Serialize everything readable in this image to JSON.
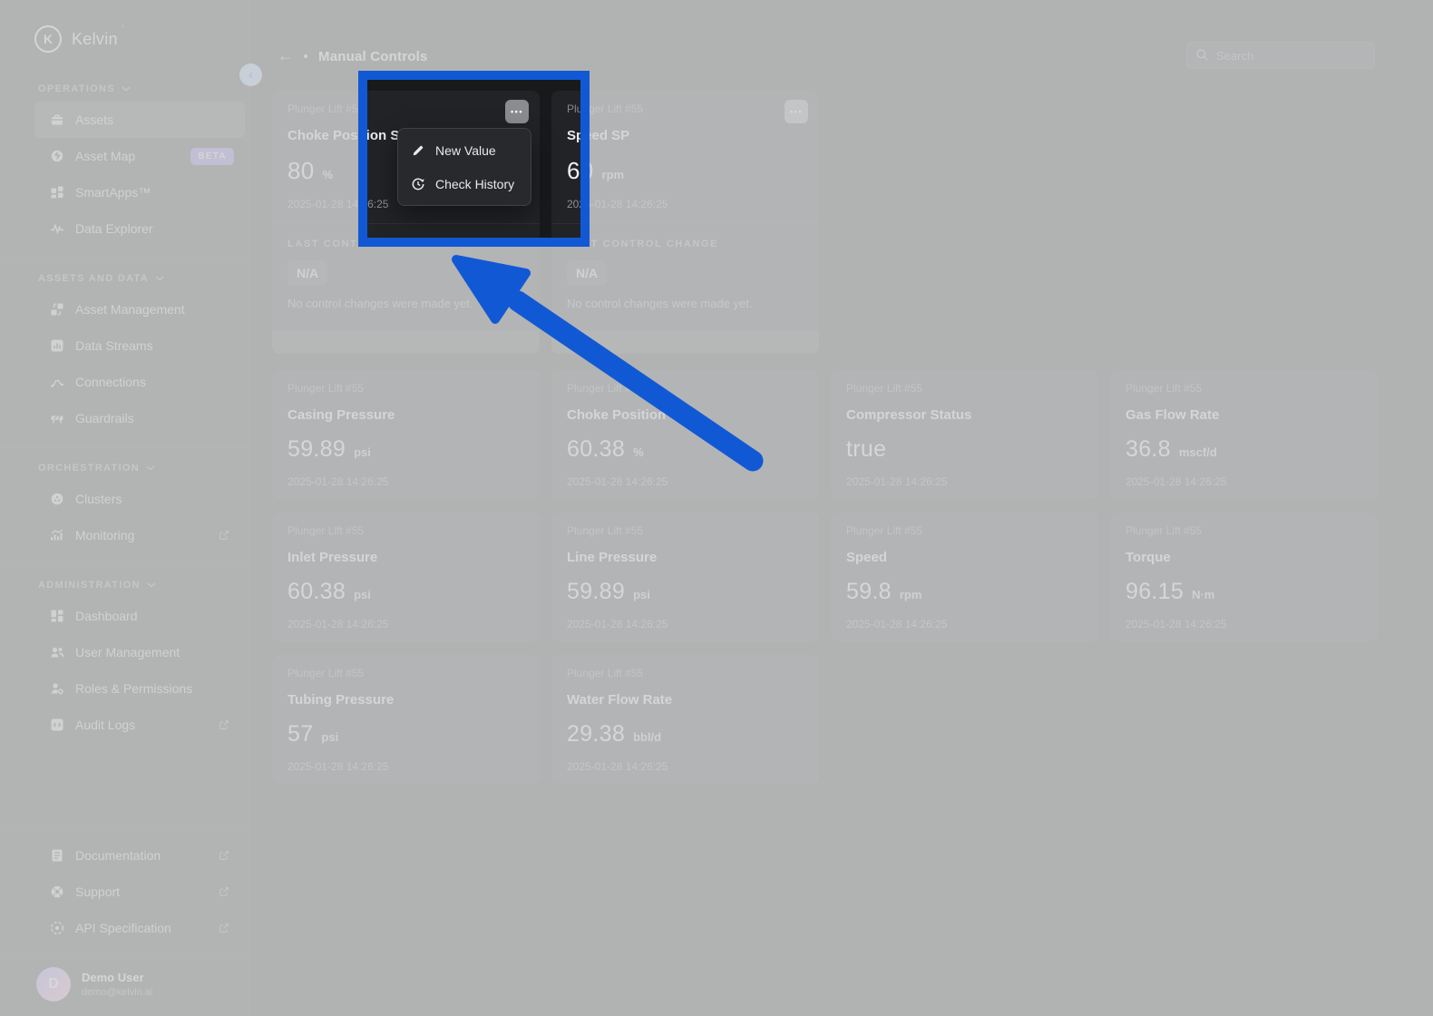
{
  "brand": {
    "name": "Kelvin",
    "mark": "˙",
    "initial": "K"
  },
  "header": {
    "back_icon": "←",
    "title": "Manual Controls",
    "search_placeholder": "Search"
  },
  "icons": {
    "ellipsis": "•••",
    "collapse": "‹"
  },
  "sidebar": {
    "sections": [
      {
        "label": "OPERATIONS",
        "items": [
          {
            "label": "Assets"
          },
          {
            "label": "Asset Map",
            "badge": "BETA"
          },
          {
            "label": "SmartApps™"
          },
          {
            "label": "Data Explorer"
          }
        ]
      },
      {
        "label": "ASSETS AND DATA",
        "items": [
          {
            "label": "Asset Management"
          },
          {
            "label": "Data Streams"
          },
          {
            "label": "Connections"
          },
          {
            "label": "Guardrails"
          }
        ]
      },
      {
        "label": "ORCHESTRATION",
        "items": [
          {
            "label": "Clusters"
          },
          {
            "label": "Monitoring",
            "external": true
          }
        ]
      },
      {
        "label": "ADMINISTRATION",
        "items": [
          {
            "label": "Dashboard"
          },
          {
            "label": "User Management"
          },
          {
            "label": "Roles & Permissions"
          },
          {
            "label": "Audit Logs",
            "external": true
          }
        ]
      }
    ],
    "footer_links": [
      {
        "label": "Documentation",
        "external": true
      },
      {
        "label": "Support",
        "external": true
      },
      {
        "label": "API Specification",
        "external": true
      }
    ],
    "user": {
      "initial": "D",
      "name": "Demo User",
      "email": "demo@kelvin.ai"
    }
  },
  "control_cards": [
    {
      "asset": "Plunger Lift #55",
      "title": "Choke Position SP",
      "value": "80",
      "unit": "%",
      "timestamp": "2025-01-28 14:26:25",
      "section_label": "LAST CONTROL CHANGE",
      "status": "N/A",
      "note": "No control changes were made yet."
    },
    {
      "asset": "Plunger Lift #55",
      "title": "Speed SP",
      "value": "60",
      "unit": "rpm",
      "timestamp": "2025-01-28 14:26:25",
      "section_label": "LAST CONTROL CHANGE",
      "status": "N/A",
      "note": "No control changes were made yet."
    }
  ],
  "metric_cards": [
    {
      "asset": "Plunger Lift #55",
      "title": "Casing Pressure",
      "value": "59.89",
      "unit": "psi",
      "timestamp": "2025-01-28 14:26:25"
    },
    {
      "asset": "Plunger Lift #55",
      "title": "Choke Position",
      "value": "60.38",
      "unit": "%",
      "timestamp": "2025-01-28 14:26:25"
    },
    {
      "asset": "Plunger Lift #55",
      "title": "Compressor Status",
      "value": "true",
      "unit": "",
      "timestamp": "2025-01-28 14:26:25"
    },
    {
      "asset": "Plunger Lift #55",
      "title": "Gas Flow Rate",
      "value": "36.8",
      "unit": "mscf/d",
      "timestamp": "2025-01-28 14:26:25"
    },
    {
      "asset": "Plunger Lift #55",
      "title": "Inlet Pressure",
      "value": "60.38",
      "unit": "psi",
      "timestamp": "2025-01-28 14:26:25"
    },
    {
      "asset": "Plunger Lift #55",
      "title": "Line Pressure",
      "value": "59.89",
      "unit": "psi",
      "timestamp": "2025-01-28 14:26:25"
    },
    {
      "asset": "Plunger Lift #55",
      "title": "Speed",
      "value": "59.8",
      "unit": "rpm",
      "timestamp": "2025-01-28 14:26:25"
    },
    {
      "asset": "Plunger Lift #55",
      "title": "Torque",
      "value": "96.15",
      "unit": "N·m",
      "timestamp": "2025-01-28 14:26:25"
    },
    {
      "asset": "Plunger Lift #55",
      "title": "Tubing Pressure",
      "value": "57",
      "unit": "psi",
      "timestamp": "2025-01-28 14:26:25"
    },
    {
      "asset": "Plunger Lift #55",
      "title": "Water Flow Rate",
      "value": "29.38",
      "unit": "bbl/d",
      "timestamp": "2025-01-28 14:26:25"
    }
  ],
  "context_menu": {
    "items": [
      {
        "label": "New Value"
      },
      {
        "label": "Check History"
      }
    ]
  },
  "colors": {
    "highlight_border": "#1159d4",
    "arrow": "#1159d4",
    "overlay": "rgba(207,208,209,0.84)",
    "beta_badge": "#7a5ce0",
    "avatar_gradient_start": "#a78bfa",
    "avatar_gradient_end": "#f0a6ce"
  }
}
